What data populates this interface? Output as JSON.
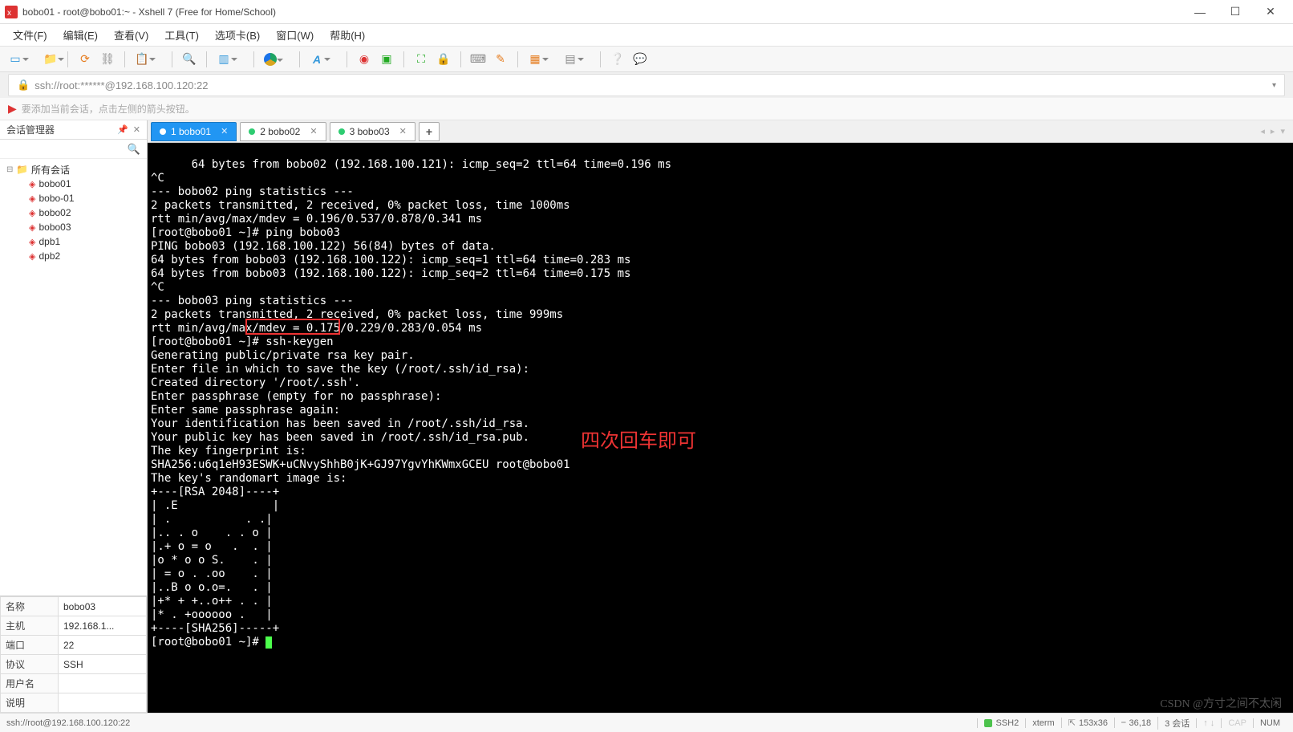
{
  "window": {
    "title": "bobo01 - root@bobo01:~ - Xshell 7 (Free for Home/School)"
  },
  "menu": {
    "items": [
      "文件(F)",
      "编辑(E)",
      "查看(V)",
      "工具(T)",
      "选项卡(B)",
      "窗口(W)",
      "帮助(H)"
    ]
  },
  "address": {
    "url": "ssh://root:******@192.168.100.120:22"
  },
  "tip": "要添加当前会话，点击左侧的箭头按钮。",
  "sidebar": {
    "title": "会话管理器",
    "root": "所有会话",
    "items": [
      "bobo01",
      "bobo-01",
      "bobo02",
      "bobo03",
      "dpb1",
      "dpb2"
    ]
  },
  "props": {
    "rows": [
      {
        "k": "名称",
        "v": "bobo03"
      },
      {
        "k": "主机",
        "v": "192.168.1..."
      },
      {
        "k": "端口",
        "v": "22"
      },
      {
        "k": "协议",
        "v": "SSH"
      },
      {
        "k": "用户名",
        "v": ""
      },
      {
        "k": "说明",
        "v": ""
      }
    ]
  },
  "tabs": {
    "items": [
      {
        "name": "1 bobo01",
        "active": true
      },
      {
        "name": "2 bobo02",
        "active": false
      },
      {
        "name": "3 bobo03",
        "active": false
      }
    ]
  },
  "terminal": {
    "lines": [
      "64 bytes from bobo02 (192.168.100.121): icmp_seq=2 ttl=64 time=0.196 ms",
      "^C",
      "--- bobo02 ping statistics ---",
      "2 packets transmitted, 2 received, 0% packet loss, time 1000ms",
      "rtt min/avg/max/mdev = 0.196/0.537/0.878/0.341 ms",
      "[root@bobo01 ~]# ping bobo03",
      "PING bobo03 (192.168.100.122) 56(84) bytes of data.",
      "64 bytes from bobo03 (192.168.100.122): icmp_seq=1 ttl=64 time=0.283 ms",
      "64 bytes from bobo03 (192.168.100.122): icmp_seq=2 ttl=64 time=0.175 ms",
      "^C",
      "--- bobo03 ping statistics ---",
      "2 packets transmitted, 2 received, 0% packet loss, time 999ms",
      "rtt min/avg/max/mdev = 0.175/0.229/0.283/0.054 ms",
      "[root@bobo01 ~]# ssh-keygen",
      "Generating public/private rsa key pair.",
      "Enter file in which to save the key (/root/.ssh/id_rsa):",
      "Created directory '/root/.ssh'.",
      "Enter passphrase (empty for no passphrase):",
      "Enter same passphrase again:",
      "Your identification has been saved in /root/.ssh/id_rsa.",
      "Your public key has been saved in /root/.ssh/id_rsa.pub.",
      "The key fingerprint is:",
      "SHA256:u6q1eH93ESWK+uCNvyShhB0jK+GJ97YgvYhKWmxGCEU root@bobo01",
      "The key's randomart image is:",
      "+---[RSA 2048]----+",
      "| .E              |",
      "| .           . .|",
      "|.. . o    . . o |",
      "|.+ o = o   .  . |",
      "|o * o o S.    . |",
      "| = o . .oo    . |",
      "|..B o o.o=.   . |",
      "|+* + +..o++ . . |",
      "|* . +oooooo .   |",
      "+----[SHA256]-----+",
      "[root@bobo01 ~]# "
    ],
    "annotation": "四次回车即可",
    "highlight_cmd": "ssh-keygen"
  },
  "status": {
    "left": "ssh://root@192.168.100.120:22",
    "ssh": "SSH2",
    "term": "xterm",
    "size": "153x36",
    "cursor": "36,18",
    "sess": "3 会话",
    "cap": "CAP",
    "num": "NUM"
  },
  "watermark": "CSDN @方寸之间不太闲"
}
